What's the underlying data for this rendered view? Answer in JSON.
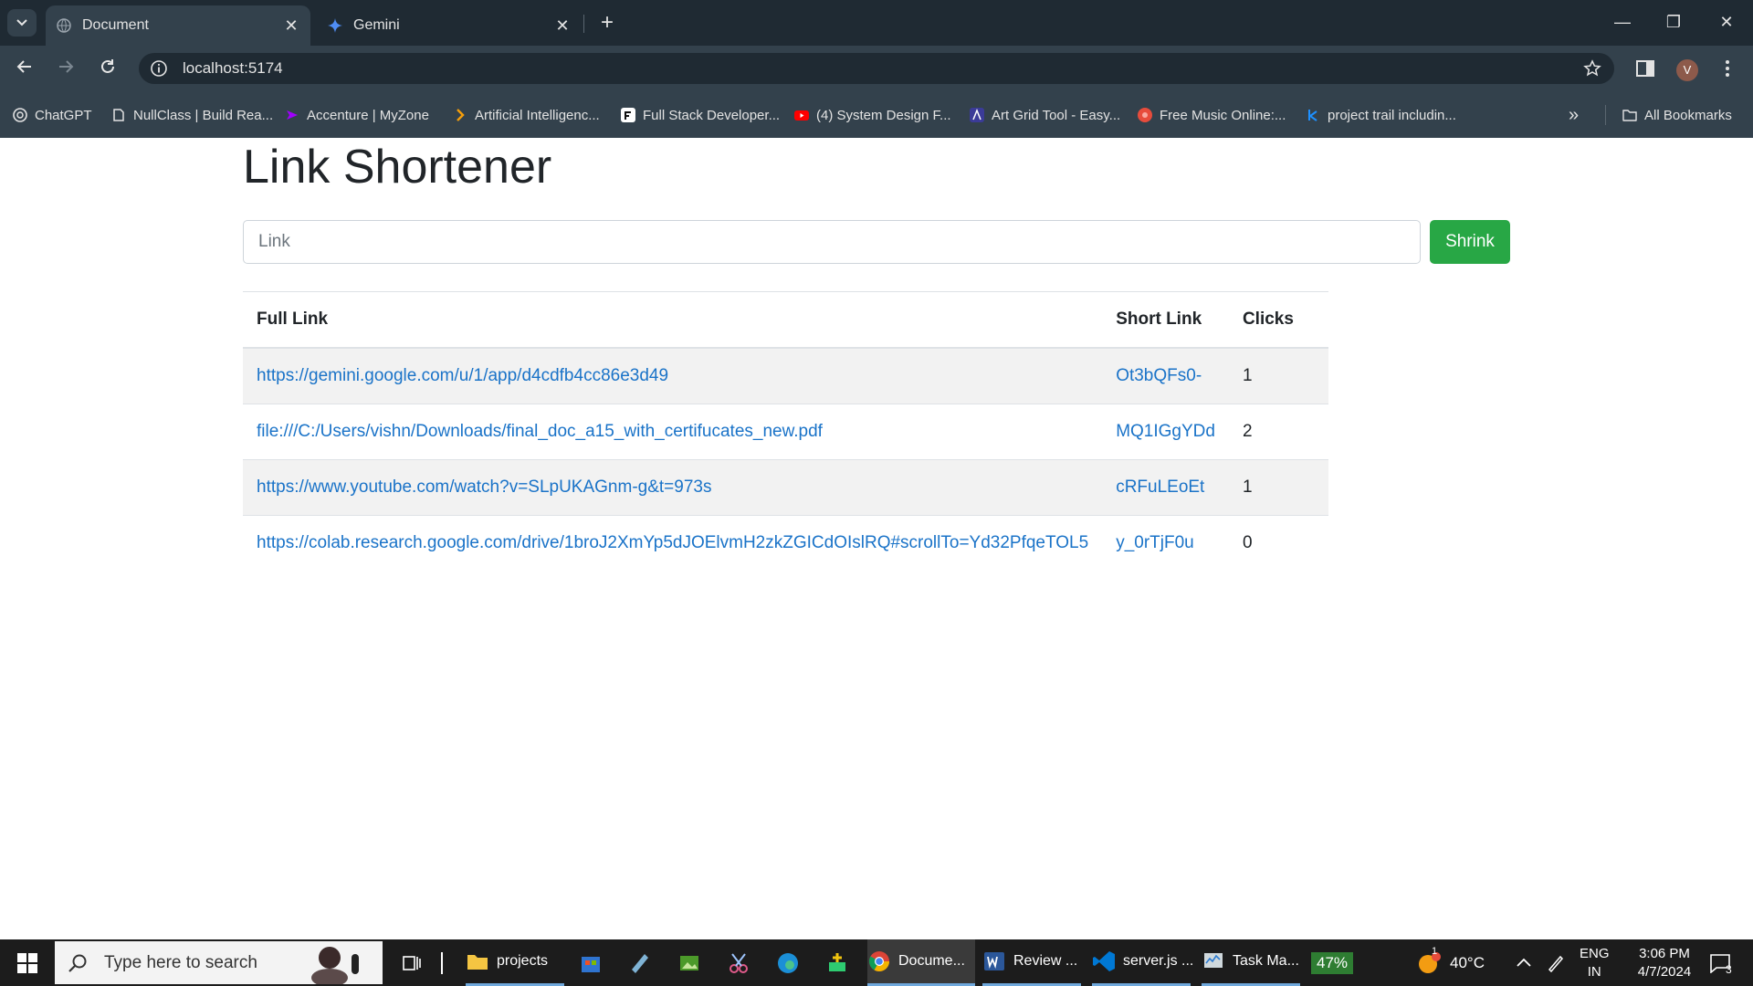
{
  "browser": {
    "tabs": [
      {
        "title": "Document",
        "active": true
      },
      {
        "title": "Gemini",
        "active": false
      }
    ],
    "url": "localhost:5174",
    "profile_initial": "V",
    "bookmarks": [
      {
        "label": "ChatGPT",
        "icon": "chatgpt-icon",
        "color": "#10a37f"
      },
      {
        "label": "NullClass | Build Rea...",
        "icon": "page-icon",
        "color": "#ffffff"
      },
      {
        "label": "Accenture | MyZone",
        "icon": "accenture-icon",
        "color": "#a100ff"
      },
      {
        "label": "Artificial Intelligenc...",
        "icon": "chevron-icon",
        "color": "#f59e0b"
      },
      {
        "label": "Full Stack Developer...",
        "icon": "f-icon",
        "color": "#ffffff"
      },
      {
        "label": "(4) System Design F...",
        "icon": "youtube-icon",
        "color": "#ff0000"
      },
      {
        "label": "Art Grid Tool - Easy...",
        "icon": "artgrid-icon",
        "color": "#3b3b98"
      },
      {
        "label": "Free Music Online:...",
        "icon": "music-icon",
        "color": "#e74c3c"
      },
      {
        "label": "project trail includin...",
        "icon": "k-icon",
        "color": "#1e90ff"
      }
    ],
    "all_bookmarks_label": "All Bookmarks"
  },
  "app": {
    "title": "Link Shortener",
    "input_placeholder": "Link",
    "shrink_label": "Shrink",
    "columns": [
      "Full Link",
      "Short Link",
      "Clicks"
    ],
    "rows": [
      {
        "full": "https://gemini.google.com/u/1/app/d4cdfb4cc86e3d49",
        "short": "Ot3bQFs0-",
        "clicks": "1"
      },
      {
        "full": "file:///C:/Users/vishn/Downloads/final_doc_a15_with_certifucates_new.pdf",
        "short": "MQ1IGgYDd",
        "clicks": "2"
      },
      {
        "full": "https://www.youtube.com/watch?v=SLpUKAGnm-g&t=973s",
        "short": "cRFuLEoEt",
        "clicks": "1"
      },
      {
        "full": "https://colab.research.google.com/drive/1broJ2XmYp5dJOElvmH2zkZGICdOIslRQ#scrollTo=Yd32PfqeTOL5",
        "short": "y_0rTjF0u",
        "clicks": "0"
      }
    ],
    "colors": {
      "accent_green": "#28a745",
      "link_blue": "#1a73c8"
    }
  },
  "taskbar": {
    "search_placeholder": "Type here to search",
    "items": [
      {
        "label": "projects",
        "icon": "folder-icon"
      },
      {
        "label": "Docume...",
        "icon": "chrome-icon"
      },
      {
        "label": "Review ...",
        "icon": "word-icon"
      },
      {
        "label": "server.js ...",
        "icon": "vscode-icon"
      },
      {
        "label": "Task Ma...",
        "icon": "task-manager-icon"
      }
    ],
    "battery": "47%",
    "weather_temp": "40°C",
    "weather_badge": "1",
    "lang_top": "ENG",
    "lang_bottom": "IN",
    "time": "3:06 PM",
    "date": "4/7/2024",
    "notifications": "3"
  }
}
